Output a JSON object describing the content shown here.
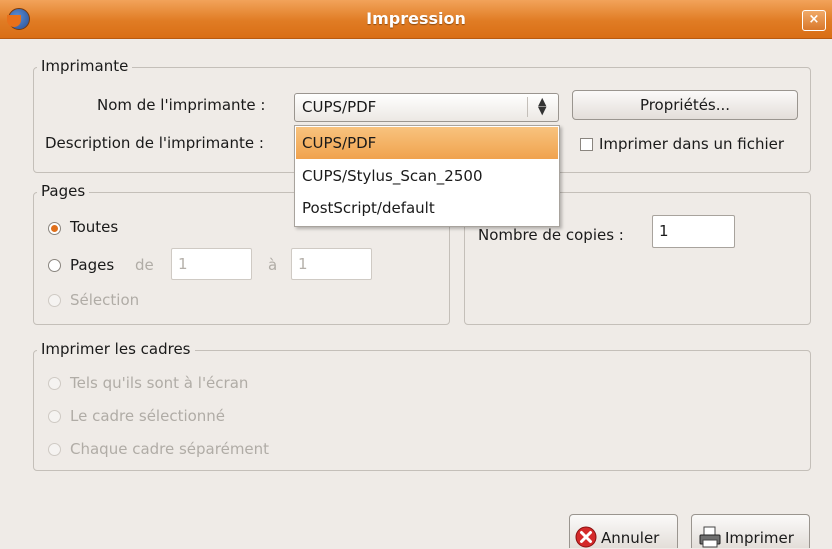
{
  "window": {
    "title": "Impression",
    "close_glyph": "×"
  },
  "printer": {
    "frame_label": "Imprimante",
    "name_label": "Nom de l'imprimante :",
    "desc_label": "Description de l'imprimante :",
    "selected": "CUPS/PDF",
    "properties_label": "Propriétés...",
    "print_to_file_label": "Imprimer dans un fichier",
    "options": [
      "CUPS/PDF",
      "CUPS/Stylus_Scan_2500",
      "PostScript/default"
    ]
  },
  "pages": {
    "frame_label": "Pages",
    "all_label": "Toutes",
    "range_label": "Pages",
    "from_label": "de",
    "from_value": "1",
    "to_label": "à",
    "to_value": "1",
    "selection_label": "Sélection"
  },
  "copies": {
    "label": "Nombre de copies :",
    "value": "1"
  },
  "frames": {
    "frame_label": "Imprimer les cadres",
    "as_shown": "Tels qu'ils sont à l'écran",
    "selected": "Le cadre sélectionné",
    "each": "Chaque cadre séparément"
  },
  "buttons": {
    "cancel": "Annuler",
    "print": "Imprimer"
  },
  "colors": {
    "titlebar": "#e07c24",
    "selection": "#f0a24e",
    "window_bg": "#efebe7"
  }
}
